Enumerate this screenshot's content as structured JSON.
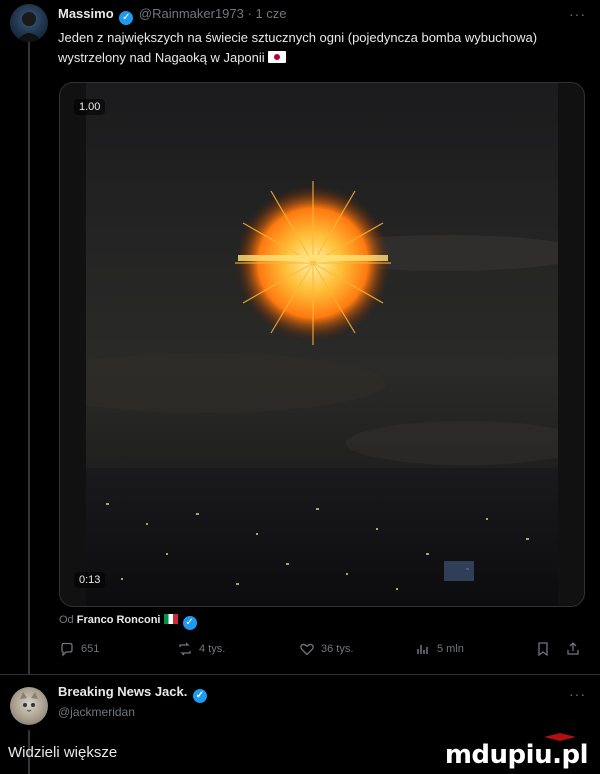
{
  "post": {
    "author_name": "Massimo",
    "author_handle": "@Rainmaker1973",
    "time": "· 1 cze",
    "more": "···",
    "text": "Jeden z największych na świecie sztucznych ogni (pojedyncza bomba wybuchowa) wystrzelony nad Nagaoką w Japonii",
    "media": {
      "zoom_badge": "1.00",
      "duration": "0:13"
    },
    "credit": {
      "prefix": "Od",
      "name": "Franco Ronconi"
    },
    "stats": {
      "replies": "651",
      "reposts": "4 tys.",
      "likes": "36 tys.",
      "views": "5 mln"
    }
  },
  "reply": {
    "author_name": "Breaking News Jack.",
    "author_handle": "@jackmeridan",
    "more": "···"
  },
  "section": {
    "title": "Widzieli większe"
  },
  "watermark": {
    "text": "mdupiu.pl"
  },
  "colors": {
    "background": "#000000",
    "text": "#e7e9ea",
    "muted": "#71767b",
    "verified": "#1d9bf0",
    "border": "#2f3336"
  }
}
